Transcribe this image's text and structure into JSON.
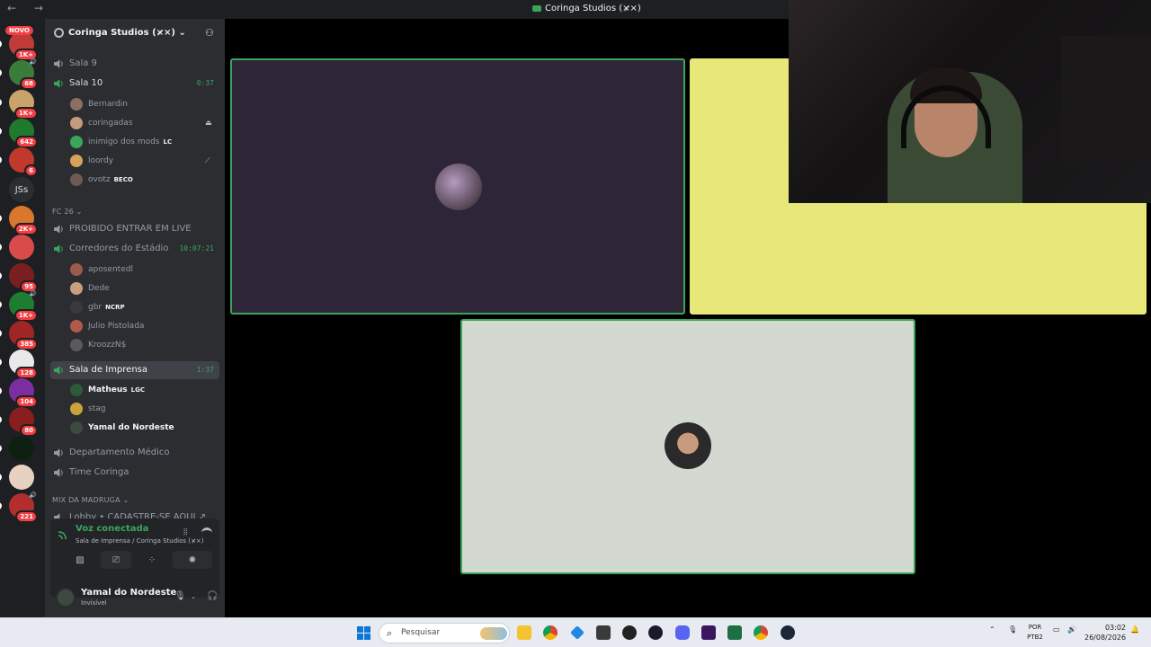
{
  "window": {
    "title": "Coringa Studios (×̷×)",
    "nav": "← →"
  },
  "rail": {
    "novo": "NOVO",
    "jss": "JSs",
    "servers": [
      {
        "badge": "1K+",
        "color": "#c23b3b"
      },
      {
        "badge": "68",
        "color": "#3a7d3a",
        "vol": "🔊"
      },
      {
        "badge": "1K+",
        "color": "#caa36b"
      },
      {
        "badge": "642",
        "color": "#1f7a2e"
      },
      {
        "badge": "6",
        "color": "#c0392b"
      },
      {
        "badge": "",
        "color": "#2b2d31"
      },
      {
        "badge": "2K+",
        "color": "#d9772c"
      },
      {
        "badge": "",
        "color": "#d94b4b"
      },
      {
        "badge": "95",
        "color": "#7a1f1f"
      },
      {
        "badge": "1K+",
        "color": "#1e7d2f",
        "vol": "🔊"
      },
      {
        "badge": "385",
        "color": "#a02525"
      },
      {
        "badge": "128",
        "color": "#e9e9e9"
      },
      {
        "badge": "104",
        "color": "#7b2ea0"
      },
      {
        "badge": "80",
        "color": "#8a1e1e"
      },
      {
        "badge": "",
        "color": "#0d2012"
      },
      {
        "badge": "",
        "color": "#e7d2c2"
      },
      {
        "badge": "221",
        "color": "#b22d2d",
        "vol": "🔊"
      }
    ]
  },
  "server": {
    "name": "Coringa Studios (×̷×)"
  },
  "channels": {
    "sala9": "Sala 9",
    "sala10": "Sala 10",
    "sala10_timer": "0:37",
    "sala10_members": [
      {
        "name": "Bernardin",
        "color": "#8d6e63"
      },
      {
        "name": "coringadas",
        "color": "#c59a7d",
        "icon": "⏏"
      },
      {
        "name": "inimigo dos mods",
        "tag": "LC",
        "color": "#3ba55c"
      },
      {
        "name": "loordy",
        "color": "#d9a05b",
        "icon": "⟋"
      },
      {
        "name": "ovotz",
        "tag": "BECO",
        "color": "#6d5a52"
      }
    ],
    "cat_fc26": "FC 26 ⌄",
    "proibido": "PROIBIDO ENTRAR EM LIVE",
    "corredores": "Corredores do Estádio",
    "corredores_timer": "10:07:21",
    "corredores_members": [
      {
        "name": "aposentedl",
        "color": "#9a5b4b"
      },
      {
        "name": "Dede",
        "color": "#c8a080"
      },
      {
        "name": "gbr",
        "tag": "NCRP",
        "color": "#3a3a3a"
      },
      {
        "name": "Julio Pistolada",
        "color": "#b05a4a"
      },
      {
        "name": "KroozzN$",
        "color": "#5a5a5a"
      }
    ],
    "imprensa": "Sala de Imprensa",
    "imprensa_timer": "1:37",
    "imprensa_members": [
      {
        "name": "Matheus",
        "tag": "LGC",
        "color": "#2f5a3a",
        "on": true
      },
      {
        "name": "stag",
        "color": "#caa33b",
        "on": false
      },
      {
        "name": "Yamal do Nordeste",
        "color": "#3c4a3f",
        "on": true
      }
    ],
    "medico": "Departamento Médico",
    "timecoringa": "Time Coringa",
    "cat_mix": "MIX DA MADRUGA ⌄",
    "lobby": "Lobby • CADASTRE-SE AQUI ↗"
  },
  "voice": {
    "status": "Voz conectada",
    "location": "Sala de Imprensa / Coringa Studios (×̷×)"
  },
  "user": {
    "name": "Yamal do Nordeste",
    "status": "Invisível"
  },
  "colors": {
    "tile1": "#2e2538",
    "tile2": "#e8e77a",
    "tile3": "#d3d9d1",
    "accent": "#3ba55c"
  },
  "taskbar": {
    "search_placeholder": "Pesquisar",
    "lang_1": "POR",
    "lang_2": "PTB2",
    "time": "03:02",
    "date": "26/08/2026"
  }
}
